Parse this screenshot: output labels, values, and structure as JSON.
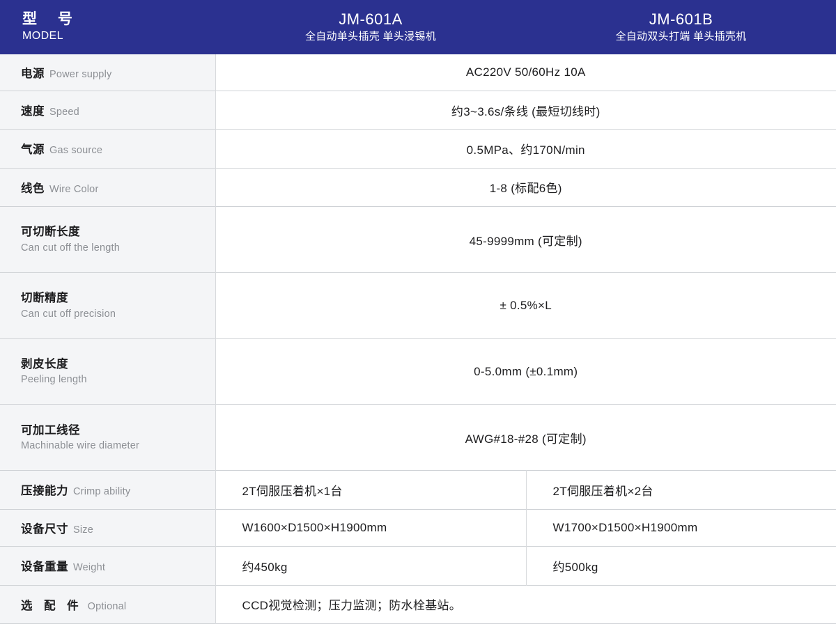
{
  "header": {
    "model_label_cn": "型 号",
    "model_label_en": "MODEL",
    "columns": [
      {
        "name": "JM-601A",
        "desc": "全自动单头插壳 单头浸锡机"
      },
      {
        "name": "JM-601B",
        "desc": "全自动双头打端 单头插壳机"
      }
    ],
    "bg_color": "#2b3190",
    "text_color": "#ffffff"
  },
  "rows": [
    {
      "label_cn": "电源",
      "label_en": "Power supply",
      "layout": "one-line",
      "merged": true,
      "value": "AC220V 50/60Hz 10A"
    },
    {
      "label_cn": "速度",
      "label_en": "Speed",
      "layout": "one-line",
      "merged": true,
      "value": "约3~3.6s/条线 (最短切线时)"
    },
    {
      "label_cn": "气源",
      "label_en": "Gas source",
      "layout": "one-line",
      "merged": true,
      "value": "0.5MPa、约170N/min"
    },
    {
      "label_cn": "线色",
      "label_en": "Wire Color",
      "layout": "one-line",
      "merged": true,
      "value": "1-8 (标配6色)"
    },
    {
      "label_cn": "可切断长度",
      "label_en": "Can cut off the length",
      "layout": "two-line",
      "merged": true,
      "value": "45-9999mm (可定制)"
    },
    {
      "label_cn": "切断精度",
      "label_en": "Can cut off precision",
      "layout": "two-line",
      "merged": true,
      "value": "± 0.5%×L"
    },
    {
      "label_cn": "剥皮长度",
      "label_en": "Peeling length",
      "layout": "two-line",
      "merged": true,
      "value": "0-5.0mm (±0.1mm)"
    },
    {
      "label_cn": "可加工线径",
      "label_en": "Machinable wire diameter",
      "layout": "two-line",
      "merged": true,
      "value": "AWG#18-#28 (可定制)"
    },
    {
      "label_cn": "压接能力",
      "label_en": "Crimp ability",
      "layout": "one-line",
      "merged": false,
      "value_a": "2T伺服压着机×1台",
      "value_b": "2T伺服压着机×2台"
    },
    {
      "label_cn": "设备尺寸",
      "label_en": "Size",
      "layout": "one-line",
      "merged": false,
      "value_a": "W1600×D1500×H1900mm",
      "value_b": "W1700×D1500×H1900mm"
    },
    {
      "label_cn": "设备重量",
      "label_en": "Weight",
      "layout": "one-line",
      "merged": false,
      "value_a": "约450kg",
      "value_b": "约500kg"
    },
    {
      "label_cn": "选 配 件",
      "label_en": "Optional",
      "layout": "one-line-spaced",
      "merged": true,
      "align": "left",
      "value": "CCD视觉检测；压力监测；防水栓基站。"
    }
  ]
}
